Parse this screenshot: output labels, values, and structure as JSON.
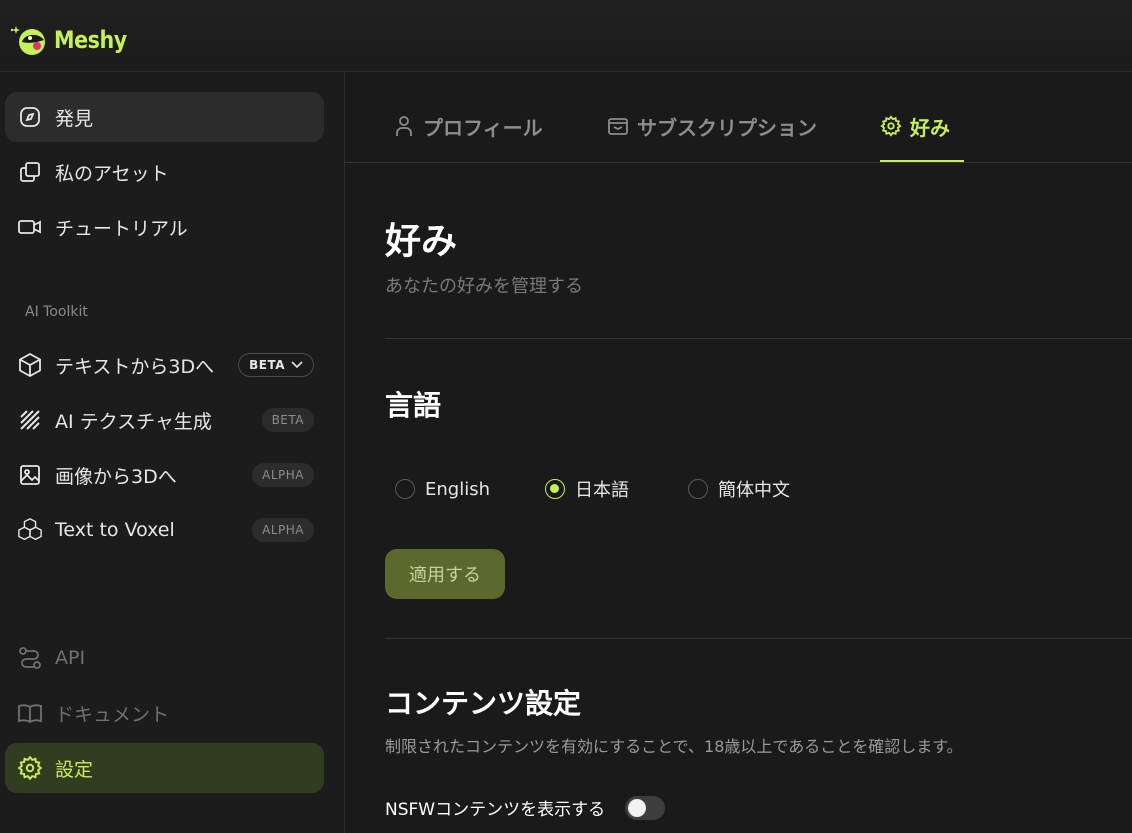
{
  "app": {
    "name": "Meshy",
    "accent": "#c5f05a"
  },
  "sidebar": {
    "items": [
      {
        "label": "発見",
        "icon": "compass-icon"
      },
      {
        "label": "私のアセット",
        "icon": "assets-icon"
      },
      {
        "label": "チュートリアル",
        "icon": "video-icon"
      }
    ],
    "toolkit_title": "AI Toolkit",
    "tools": [
      {
        "label": "テキストから3Dへ",
        "badge": "BETA",
        "icon": "cube-icon"
      },
      {
        "label": "AI テクスチャ生成",
        "badge": "BETA",
        "icon": "texture-icon"
      },
      {
        "label": "画像から3Dへ",
        "badge": "ALPHA",
        "icon": "image-icon"
      },
      {
        "label": "Text to Voxel",
        "badge": "ALPHA",
        "icon": "voxel-icon"
      }
    ],
    "bottom": [
      {
        "label": "API",
        "icon": "api-icon"
      },
      {
        "label": "ドキュメント",
        "icon": "book-icon"
      },
      {
        "label": "設定",
        "icon": "gear-icon"
      }
    ]
  },
  "tabs": [
    {
      "label": "プロフィール",
      "icon": "user-icon"
    },
    {
      "label": "サブスクリプション",
      "icon": "wallet-icon"
    },
    {
      "label": "好み",
      "icon": "gear-icon"
    }
  ],
  "page": {
    "title": "好み",
    "subtitle": "あなたの好みを管理する",
    "language_title": "言語",
    "languages": [
      "English",
      "日本語",
      "簡体中文"
    ],
    "selected_language": "日本語",
    "apply_label": "適用する",
    "content_title": "コンテンツ設定",
    "content_desc": "制限されたコンテンツを有効にすることで、18歳以上であることを確認します。",
    "nsfw_label": "NSFWコンテンツを表示する",
    "nsfw_enabled": false
  }
}
